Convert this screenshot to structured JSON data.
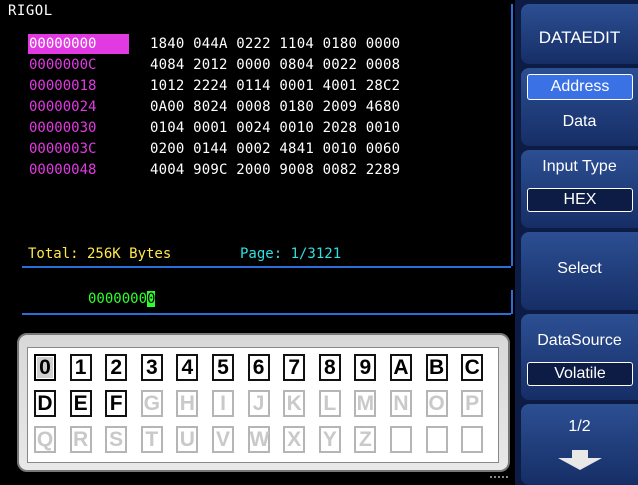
{
  "brand": "RIGOL",
  "rows": [
    {
      "addr": "00000000",
      "cells": "1840 044A 0222 1104 0180 0000"
    },
    {
      "addr": "0000000C",
      "cells": "4084 2012 0000 0804 0022 0008"
    },
    {
      "addr": "00000018",
      "cells": "1012 2224 0114 0001 4001 28C2"
    },
    {
      "addr": "00000024",
      "cells": "0A00 8024 0008 0180 2009 4680"
    },
    {
      "addr": "00000030",
      "cells": "0104 0001 0024 0010 2028 0010"
    },
    {
      "addr": "0000003C",
      "cells": "0200 0144 0002 4841 0010 0060"
    },
    {
      "addr": "00000048",
      "cells": "4004 909C 2000 9008 0082 2289"
    }
  ],
  "total_label": "Total: 256K Bytes",
  "page_label": "Page: 1/3121",
  "address_input": {
    "prefix": "0000000",
    "cursor_char": "0"
  },
  "keyboard": {
    "row1": [
      "0",
      "1",
      "2",
      "3",
      "4",
      "5",
      "6",
      "7",
      "8",
      "9",
      "A",
      "B",
      "C"
    ],
    "row2": [
      "D",
      "E",
      "F",
      "G",
      "H",
      "I",
      "J",
      "K",
      "L",
      "M",
      "N",
      "O",
      "P"
    ],
    "row3": [
      "Q",
      "R",
      "S",
      "T",
      "U",
      "V",
      "W",
      "X",
      "Y",
      "Z",
      "",
      "",
      ""
    ],
    "enabled": [
      "0",
      "1",
      "2",
      "3",
      "4",
      "5",
      "6",
      "7",
      "8",
      "9",
      "A",
      "B",
      "C",
      "D",
      "E",
      "F"
    ]
  },
  "menu": {
    "title": "DATAEDIT",
    "address": "Address",
    "data": "Data",
    "input_type_label": "Input Type",
    "input_type_value": "HEX",
    "select": "Select",
    "data_source_label": "DataSource",
    "data_source_value": "Volatile",
    "page": "1/2"
  }
}
